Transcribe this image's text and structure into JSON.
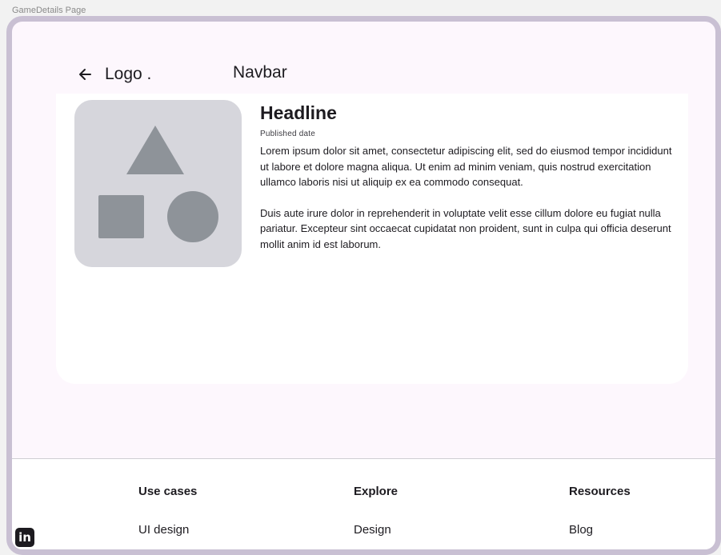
{
  "frame_label": "GameDetails Page",
  "navbar": {
    "back_icon": "arrow-left-icon",
    "logo": "Logo .",
    "title": "Navbar"
  },
  "media": {
    "icon": "shapes-placeholder-icon"
  },
  "article": {
    "headline": "Headline",
    "published": "Published date",
    "paragraphs": [
      "Lorem ipsum dolor sit amet, consectetur adipiscing elit, sed do eiusmod tempor incididunt ut labore et dolore magna aliqua. Ut enim ad minim veniam, quis nostrud exercitation ullamco laboris nisi ut aliquip ex ea commodo consequat.",
      "Duis aute irure dolor in reprehenderit in voluptate velit esse cillum dolore eu fugiat nulla pariatur. Excepteur sint occaecat cupidatat non proident, sunt in culpa qui officia deserunt mollit anim id est laborum."
    ]
  },
  "footer": {
    "columns": [
      {
        "heading": "Use cases",
        "link": "UI design"
      },
      {
        "heading": "Explore",
        "link": "Design"
      },
      {
        "heading": "Resources",
        "link": "Blog"
      }
    ],
    "social_icon": "linkedin-icon",
    "social_label": "in"
  },
  "colors": {
    "background": "#fdf7fd",
    "frame": "#c9c0d3",
    "placeholder_bg": "#d6d6dc",
    "placeholder_shape": "#8e9399"
  }
}
